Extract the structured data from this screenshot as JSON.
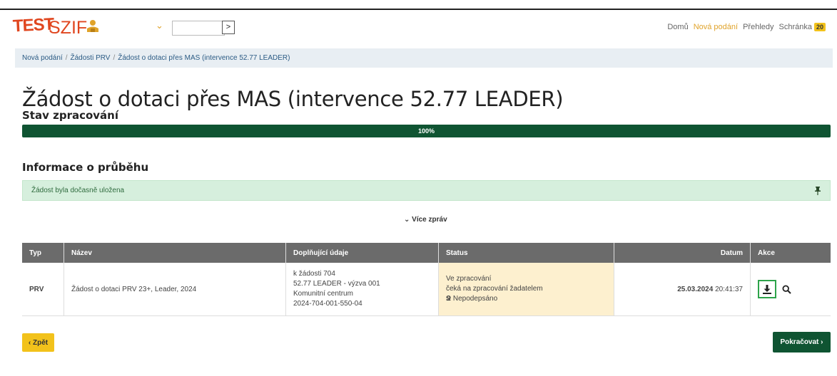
{
  "header": {
    "logo_test": "TEST",
    "logo_szif": "SZIF",
    "role_value": "",
    "go_label": ">",
    "nav": [
      "Domů",
      "Nová podání",
      "Přehledy",
      "Schránka"
    ],
    "inbox_count": "20"
  },
  "breadcrumb": [
    "Nová podání",
    "Žádosti PRV",
    "Žádost o dotaci přes MAS (intervence 52.77 LEADER)"
  ],
  "page_title": "Žádost o dotaci přes MAS (intervence 52.77 LEADER)",
  "progress": {
    "label": "Stav zpracování",
    "value_text": "100%",
    "value": 100
  },
  "info": {
    "label": "Informace o průběhu",
    "alert": "Žádost byla dočasně uložena",
    "more": "Více zpráv"
  },
  "table": {
    "headers": [
      "Typ",
      "Název",
      "Doplňující údaje",
      "Status",
      "Datum",
      "Akce"
    ],
    "row": {
      "typ": "PRV",
      "nazev": "Žádost o dotaci PRV 23+, Leader, 2024",
      "extra": [
        "k žádosti 704",
        "52.77 LEADER - výzva 001",
        "Komunitní centrum",
        "2024-704-001-550-04"
      ],
      "status": [
        "Ve zpracování",
        "čeká na zpracování žadatelem",
        "Nepodepsáno"
      ],
      "date": "25.03.2024",
      "time": "20:41:37"
    }
  },
  "buttons": {
    "back": "Zpět",
    "next": "Pokračovat"
  },
  "colors": {
    "brand": "#e0461f",
    "accent": "#e0a32a",
    "primary": "#0f5432",
    "warning": "#f2c21b"
  }
}
